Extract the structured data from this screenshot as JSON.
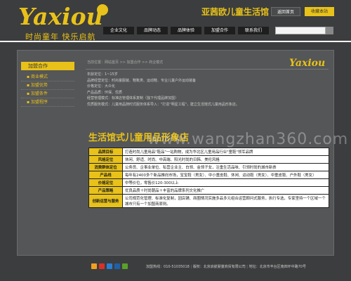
{
  "header": {
    "logo_text": "Yaxiou",
    "slogan": "时尚童年 快乐启航",
    "brand_cn": "亚茜欧儿童生活馆",
    "home_btn": "返回首页",
    "fav_btn": "收藏本站"
  },
  "nav": {
    "items": [
      "企业文化",
      "品牌动态",
      "品牌体验",
      "加盟合作",
      "联系我们"
    ]
  },
  "sidebar": {
    "heading": "加盟合作",
    "items": [
      "商业模式",
      "加盟优势",
      "加盟条件",
      "加盟程序"
    ]
  },
  "main": {
    "breadcrumb": "当前位置：网站首页 >> 加盟合作 >> 商业模式",
    "logo_small": "Yaxiou",
    "info_lines": [
      "年龄定位：1~15岁",
      "品牌经营定位：时尚童服装、鞋靴类、运动鞋、专业儿童户外运动装备",
      "价格定位：大众化",
      "产品品质：环保、优质",
      "经营管理模式：标准店管理体系复制（独下代理品牌加盟）",
      "优质服务模式：儿童用品随时式服务体系导入：\"打造\"明星工程\"，建立生活馆式儿童用品形象店。"
    ],
    "store_title": "生活馆式儿童用品形象店",
    "watermark": "www.wangzhan360.com",
    "table": [
      {
        "k": "品牌目标",
        "v": "打造时尚儿童用品\"鞋品\"一站购物，成为华北区儿童用品行业\"童鞋\"领军品牌"
      },
      {
        "k": "风格定位",
        "v": "休闲、舒适、时尚、中高端、阳光时尚的日韩、美伦风格"
      },
      {
        "k": "消费群体定位",
        "v": "公务员、企事业单位、私营企业主、白领、金领子女，注重生活品味、引领时尚的城市新贵"
      },
      {
        "k": "产品线",
        "v": "每年有2400多个新品推向市场，宝宝鞋（男女）、中小童皮鞋、休闲、运动鞋（男女）、中童皮鞋、户外鞋（男女）"
      },
      {
        "k": "价格定位",
        "v": "中等价位，零售价120-300以上"
      },
      {
        "k": "产品策略",
        "v": "优良品质＋时尚朝品＋丰富的品牌系列文化推广"
      },
      {
        "k": "创新运营与服务",
        "v": "公司规范化管理、标准化复制，因店铺、商圈情况实施多品多元组合运营顾问式服务，执行专选，专家坚持一个区域一个城市只有一个加盟商原则。"
      }
    ]
  },
  "footer": {
    "copyright": "加盟热线：",
    "phone": "010-51035018",
    "company": "版权：北京启航婴童商贸有限公司",
    "address": "地址：北京市丰台区南四环中路70号"
  },
  "colors": {
    "accent": "#e8c21a",
    "background": "#3c3d3e",
    "panel": "#555657"
  }
}
